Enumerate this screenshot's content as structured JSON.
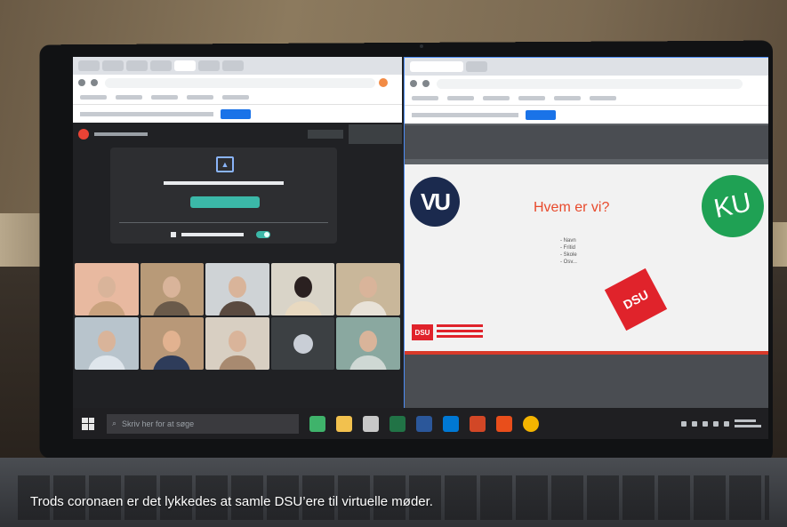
{
  "caption": "Trods coronaen er det lykkedes at samle DSU’ere til virtuelle møder.",
  "slide": {
    "title": "Hvem er vi?",
    "bullets": [
      "Navn",
      "Fritid",
      "Skole",
      "Osv..."
    ],
    "logo_vu": "VU",
    "logo_ku": "KU",
    "logo_dsu": "DSU"
  },
  "taskbar": {
    "search_placeholder": "Skriv her for at søge"
  },
  "colors": {
    "dsu_red": "#e0232b",
    "ku_green": "#1fa154",
    "vu_navy": "#1b2a4e",
    "meet_accent": "#3bb8a8",
    "slide_title": "#e84a2c"
  },
  "icons": {
    "present_screen": "present-screen-icon",
    "windows_start": "windows-start-icon",
    "search": "search-icon",
    "speaker": "speaker-icon"
  }
}
